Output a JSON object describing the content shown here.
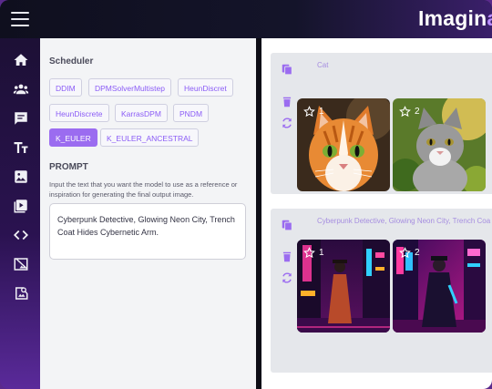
{
  "header": {
    "title_main": "Imagin",
    "title_accent": "a",
    "menu_icon": "hamburger-menu-icon"
  },
  "sidebar": {
    "icons": [
      "home-icon",
      "community-icon",
      "chat-icon",
      "text-icon",
      "image-icon",
      "video-icon",
      "code-icon",
      "image-edit-icon",
      "photo-search-icon"
    ]
  },
  "settings": {
    "scheduler_label": "Scheduler",
    "schedulers": [
      "DDIM",
      "DPMSolverMultistep",
      "HeunDiscret",
      "HeunDiscrete",
      "KarrasDPM",
      "PNDM",
      "K_EULER",
      "K_EULER_ANCESTRAL"
    ],
    "selected_scheduler": "K_EULER",
    "prompt_label": "PROMPT",
    "prompt_help": "Input the text that you want the model to use as a reference or inspiration for generating the final output image.",
    "prompt_value": "Cyberpunk Detective, Glowing Neon City, Trench Coat Hides Cybernetic Arm."
  },
  "gallery": {
    "cards": [
      {
        "prompt": "Cat",
        "images": [
          {
            "index": "1"
          },
          {
            "index": "2"
          }
        ]
      },
      {
        "prompt": "Cyberpunk Detective, Glowing Neon City, Trench Coa",
        "images": [
          {
            "index": "1"
          },
          {
            "index": "2"
          }
        ]
      }
    ]
  },
  "colors": {
    "accent": "#9b6cf0",
    "chip_text": "#8b5cf6",
    "sidebar_bg": "#1a1030"
  }
}
